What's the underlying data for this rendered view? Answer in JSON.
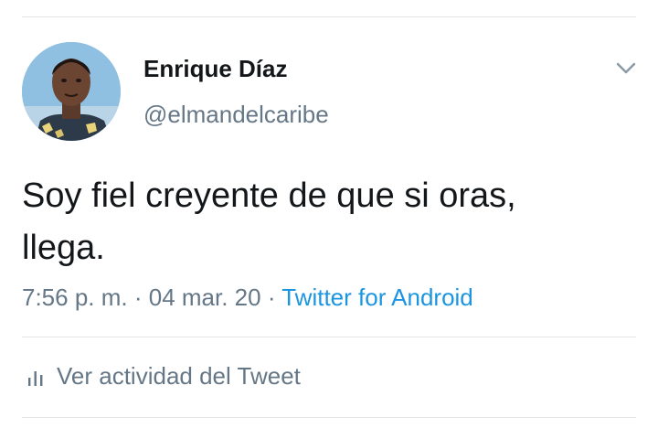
{
  "author": {
    "name": "Enrique Díaz",
    "handle": "@elmandelcaribe",
    "avatar_icon": "profile-photo"
  },
  "tweet": {
    "text_line1": "Soy fiel creyente de que si oras,",
    "text_line2": "llega."
  },
  "meta": {
    "time": "7:56 p. m.",
    "separator1": " · ",
    "date": "04 mar. 20",
    "separator2": " · ",
    "source": "Twitter for Android"
  },
  "actions": {
    "activity_label": "Ver actividad del Tweet",
    "activity_icon": "bar-chart-icon",
    "menu_icon": "chevron-down-icon"
  },
  "colors": {
    "text_primary": "#14171a",
    "text_secondary": "#657786",
    "link": "#1b95e0",
    "divider": "#e1e5e8"
  }
}
